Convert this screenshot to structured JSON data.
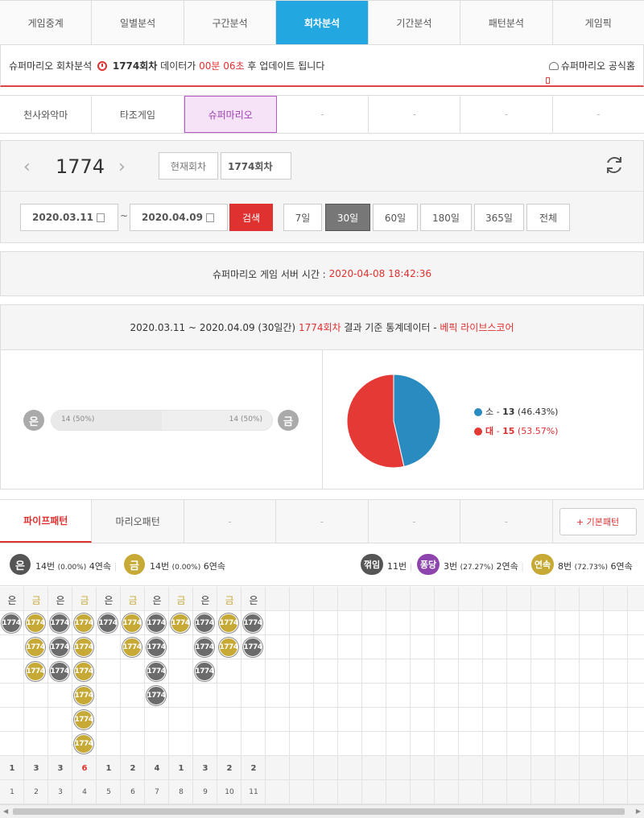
{
  "top_tabs": [
    "게임중계",
    "일별분석",
    "구간분석",
    "회차분석",
    "기간분석",
    "패턴분석",
    "게임픽"
  ],
  "info_bar": {
    "prefix": "슈퍼마리오 회차분석",
    "round": "1774회차",
    "mid": "데이터가",
    "time": "00분 06초",
    "suffix": "후 업데이트 됩니다",
    "link": "슈퍼마리오 공식홈"
  },
  "game_tabs": [
    "천사와악마",
    "타조게임",
    "슈퍼마리오",
    "-",
    "-",
    "-",
    "-"
  ],
  "round_panel": {
    "round_number": "1774",
    "current_label": "현재회차",
    "round_value": "1774회차",
    "date_from": "2020.03.11",
    "tilde": "~",
    "date_to": "2020.04.09",
    "search": "검색",
    "periods": [
      "7일",
      "30일",
      "60일",
      "180일",
      "365일",
      "전체"
    ]
  },
  "server": {
    "label": "슈퍼마리오 게임 서버 시간 :",
    "time": "2020-04-08 18:42:36"
  },
  "stats": {
    "range": "2020.03.11 ~ 2020.04.09 (30일간)",
    "round": "1774회차",
    "mid": "결과 기준 통계데이터 -",
    "brand": "베픽 라이브스코어",
    "left_label": "은",
    "left_value": "14 (50%)",
    "right_value": "14 (50%)",
    "right_label": "금",
    "silver_fraction": 0.5
  },
  "chart_data": {
    "type": "pie",
    "categories": [
      "소",
      "대"
    ],
    "values": [
      13,
      15
    ],
    "percents": [
      "(46.43%)",
      "(53.57%)"
    ],
    "colors": [
      "#2a8bc0",
      "#e53935"
    ]
  },
  "pattern_tabs": [
    "파이프패턴",
    "마리오패턴",
    "-",
    "-",
    "-",
    "-",
    "+ 기본패턴"
  ],
  "summary": {
    "silver": {
      "label": "은",
      "count": "14번",
      "pct": "(0.00%)",
      "streak": "4연속"
    },
    "gold": {
      "label": "금",
      "count": "14번",
      "pct": "(0.00%)",
      "streak": "6연속"
    },
    "turn": {
      "label": "꺾임",
      "count": "11번"
    },
    "bounce": {
      "label": "퐁당",
      "count": "3번",
      "pct": "(27.27%)",
      "streak": "2연속"
    },
    "streak": {
      "label": "연속",
      "count": "8번",
      "pct": "(72.73%)",
      "streak": "6연속"
    }
  },
  "pattern": {
    "columns": [
      {
        "type": "은",
        "color": "g",
        "count": 1,
        "label": "1774",
        "total": "1",
        "index": "1"
      },
      {
        "type": "금",
        "color": "y",
        "count": 3,
        "label": "1774",
        "total": "3",
        "index": "2"
      },
      {
        "type": "은",
        "color": "g",
        "count": 3,
        "label": "1774",
        "total": "3",
        "index": "3"
      },
      {
        "type": "금",
        "color": "y",
        "count": 6,
        "label": "1774",
        "total": "6",
        "index": "4"
      },
      {
        "type": "은",
        "color": "g",
        "count": 1,
        "label": "1774",
        "total": "1",
        "index": "5"
      },
      {
        "type": "금",
        "color": "y",
        "count": 2,
        "label": "1774",
        "total": "2",
        "index": "6"
      },
      {
        "type": "은",
        "color": "g",
        "count": 4,
        "label": "1774",
        "total": "4",
        "index": "7"
      },
      {
        "type": "금",
        "color": "y",
        "count": 1,
        "label": "1774",
        "total": "1",
        "index": "8"
      },
      {
        "type": "은",
        "color": "g",
        "count": 3,
        "label": "1774",
        "total": "3",
        "index": "9"
      },
      {
        "type": "금",
        "color": "y",
        "count": 2,
        "label": "1774",
        "total": "2",
        "index": "10"
      },
      {
        "type": "은",
        "color": "g",
        "count": 2,
        "label": "1774",
        "total": "2",
        "index": "11"
      }
    ],
    "max_total": "6"
  },
  "colors": {
    "accent": "#22a7e0",
    "red": "#e03131",
    "silver": "#6b6b6b",
    "gold": "#c7a936",
    "purple": "#8e44ad"
  }
}
